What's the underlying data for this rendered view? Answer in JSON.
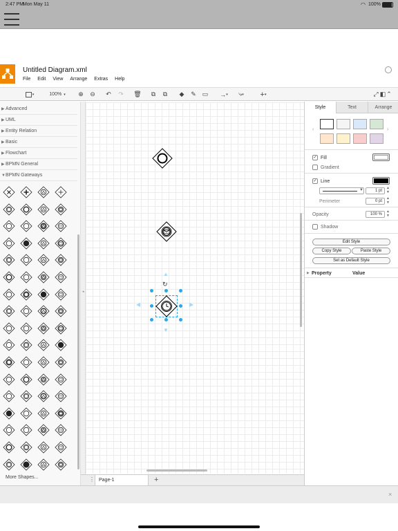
{
  "status_bar": {
    "time": "2:47 PM",
    "date": "Mon May 11",
    "battery": "100%"
  },
  "document": {
    "title": "Untitled Diagram.xml"
  },
  "menu": [
    "File",
    "Edit",
    "View",
    "Arrange",
    "Extras",
    "Help"
  ],
  "toolbar": {
    "zoom": "100%"
  },
  "sidebar": {
    "categories": [
      "Advanced",
      "UML",
      "Entity Relation",
      "Basic",
      "Flowchart",
      "BPMN General",
      "BPMN Gateways"
    ],
    "more_shapes": "More Shapes..."
  },
  "page_tabs": {
    "current": "Page-1",
    "add": "+"
  },
  "right_panel": {
    "tabs": [
      "Style",
      "Text",
      "Arrange"
    ],
    "active_tab": "Style",
    "swatches": [
      "#ffffff",
      "#f5f5f5",
      "#dae8fc",
      "#d5e8d4",
      "#ffe6cc",
      "#fff2cc",
      "#f8cecc",
      "#e1d5e7"
    ],
    "fill_label": "Fill",
    "gradient_label": "Gradient",
    "line_label": "Line",
    "line_width": "1 pt",
    "perimeter_label": "Perimeter",
    "perimeter_value": "0 pt",
    "opacity_label": "Opacity",
    "opacity_value": "100 %",
    "shadow_label": "Shadow",
    "edit_style": "Edit Style",
    "copy_style": "Copy Style",
    "paste_style": "Paste Style",
    "set_default": "Set as Default Style",
    "property_header": "Property",
    "value_header": "Value",
    "fill_color": "#ffffff",
    "line_color": "#000000"
  },
  "colors": {
    "accent": "#f08705",
    "selection": "#29a8e6"
  },
  "icons": [
    "hamburger-icon",
    "wifi-icon",
    "battery-icon",
    "drawio-logo-icon",
    "account-icon",
    "zoom-in-icon",
    "zoom-out-icon",
    "undo-icon",
    "redo-icon",
    "delete-icon",
    "to-front-icon",
    "to-back-icon",
    "fill-color-icon",
    "line-color-icon",
    "shadow-icon",
    "connection-icon",
    "waypoints-icon",
    "insert-icon",
    "fullscreen-icon",
    "format-panel-icon",
    "collapse-icon",
    "close-icon"
  ]
}
